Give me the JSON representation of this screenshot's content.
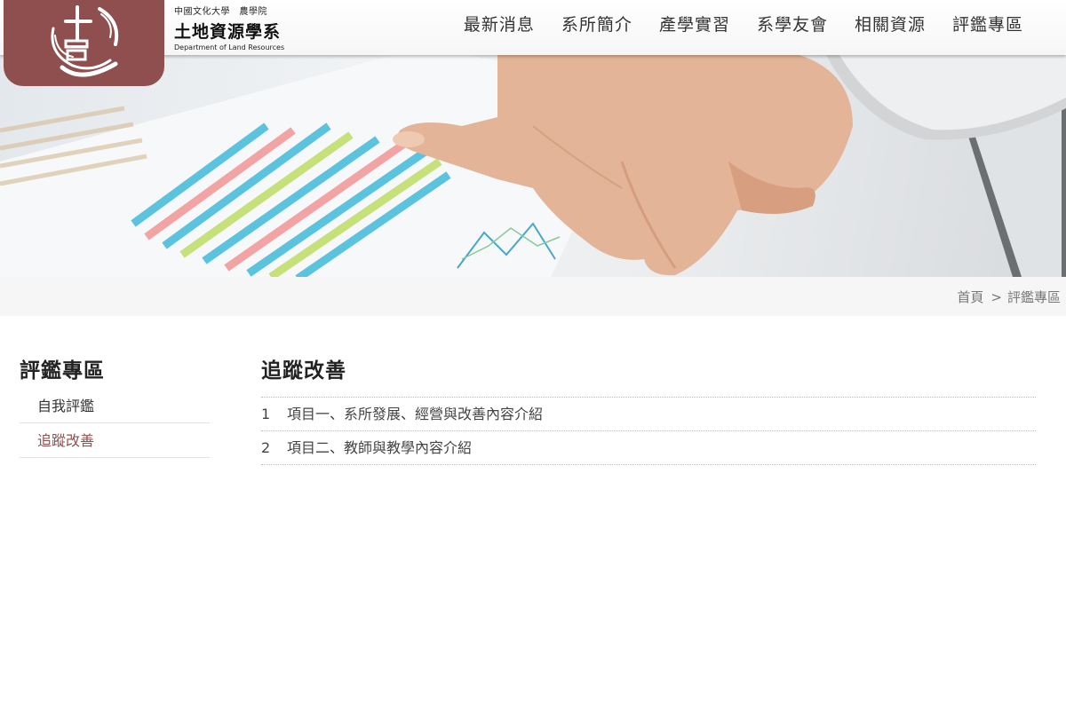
{
  "brand": {
    "top_line": "中國文化大學　農學院",
    "title": "土地資源學系",
    "english": "Department of Land Resources"
  },
  "nav": [
    "最新消息",
    "系所簡介",
    "產學實習",
    "系學友會",
    "相關資源",
    "評鑑專區"
  ],
  "breadcrumb": {
    "home": "首頁",
    "separator": ">",
    "current": "評鑑專區"
  },
  "sidebar": {
    "title": "評鑑專區",
    "items": [
      {
        "label": "自我評鑑",
        "active": false
      },
      {
        "label": "追蹤改善",
        "active": true
      }
    ]
  },
  "main": {
    "title": "追蹤改善",
    "items": [
      {
        "num": "1",
        "label": "項目一、系所發展、經營與改善內容介紹"
      },
      {
        "num": "2",
        "label": "項目二、教師與教學內容介紹"
      }
    ]
  },
  "colors": {
    "brand": "#8f4f4f",
    "active_link": "#8f4f4f"
  },
  "icons": {
    "logo": "department-seal-logo",
    "banner": "chart-and-hand-photo"
  }
}
